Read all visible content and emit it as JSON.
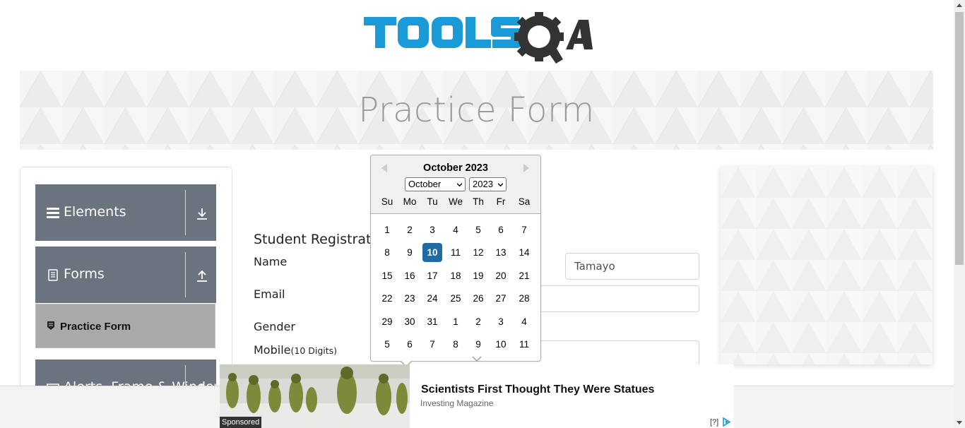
{
  "header": {
    "logo_text": "TOOLSQA"
  },
  "banner": {
    "title": "Practice Form"
  },
  "sidebar": {
    "groups": [
      {
        "label": "Elements",
        "icon": "hamburger-icon",
        "arrow": "download-arrow-icon"
      },
      {
        "label": "Forms",
        "icon": "document-icon",
        "arrow": "upload-arrow-icon"
      },
      {
        "label": "Alerts, Frame & Windows",
        "icon": "window-icon",
        "arrow": "upload-arrow-icon"
      }
    ],
    "active_item": {
      "label": "Practice Form",
      "icon": "shield-doc-icon"
    }
  },
  "form": {
    "title": "Student Registration Form",
    "labels": {
      "name": "Name",
      "email": "Email",
      "gender": "Gender",
      "mobile": "Mobile",
      "mobile_hint": "(10 Digits)"
    },
    "last_name_value": "Tamayo"
  },
  "datepicker": {
    "title": "October 2023",
    "month_select": "October",
    "year_select": "2023",
    "weekdays": [
      "Su",
      "Mo",
      "Tu",
      "We",
      "Th",
      "Fr",
      "Sa"
    ],
    "weeks": [
      [
        "1",
        "2",
        "3",
        "4",
        "5",
        "6",
        "7"
      ],
      [
        "8",
        "9",
        "10",
        "11",
        "12",
        "13",
        "14"
      ],
      [
        "15",
        "16",
        "17",
        "18",
        "19",
        "20",
        "21"
      ],
      [
        "22",
        "23",
        "24",
        "25",
        "26",
        "27",
        "28"
      ],
      [
        "29",
        "30",
        "31",
        "1",
        "2",
        "3",
        "4"
      ],
      [
        "5",
        "6",
        "7",
        "8",
        "9",
        "10",
        "11"
      ]
    ],
    "selected_day": "10",
    "selected_color": "#216ba5"
  },
  "ad": {
    "headline": "Scientists First Thought They Were Statues",
    "source": "Investing Magazine",
    "sponsored": "Sponsored",
    "info": "[?]"
  },
  "colors": {
    "sidebar_group": "#6b737e",
    "sidebar_active": "#a9a9a9",
    "logo_blue": "#1a9bd7",
    "logo_dark": "#333333"
  }
}
